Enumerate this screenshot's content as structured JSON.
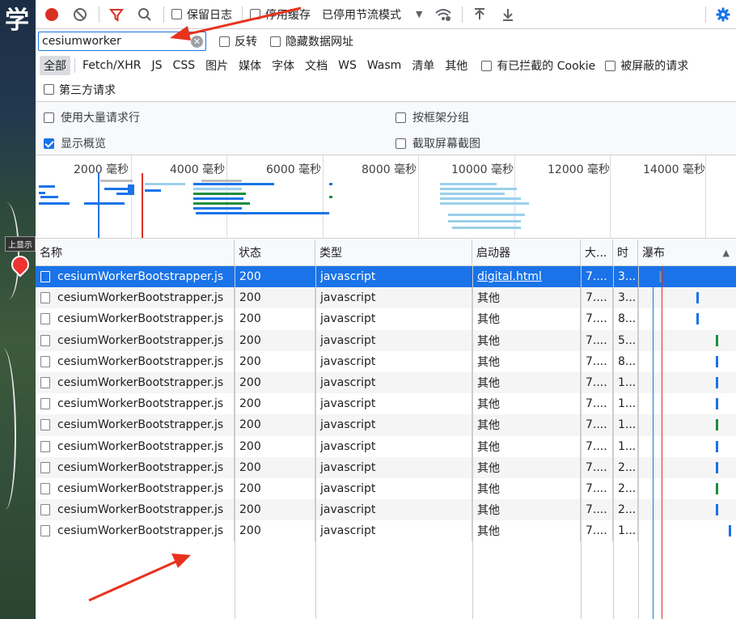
{
  "map": {
    "label": "上显示"
  },
  "toolbar": {
    "preserve_log": "保留日志",
    "disable_cache": "停用缓存",
    "throttle": "已停用节流模式"
  },
  "filter": {
    "value": "cesiumworker",
    "invert": "反转",
    "hide_data_urls": "隐藏数据网址"
  },
  "types": [
    "全部",
    "Fetch/XHR",
    "JS",
    "CSS",
    "图片",
    "媒体",
    "字体",
    "文档",
    "WS",
    "Wasm",
    "清单",
    "其他"
  ],
  "blocked_cookies": "有已拦截的 Cookie",
  "blocked_requests": "被屏蔽的请求",
  "third_party": "第三方请求",
  "settings": {
    "big_rows": "使用大量请求行",
    "group_by_frame": "按框架分组",
    "show_overview": "显示概览",
    "capture_screenshots": "截取屏幕截图"
  },
  "overview": {
    "ticks": [
      "2000 毫秒",
      "4000 毫秒",
      "6000 毫秒",
      "8000 毫秒",
      "10000 毫秒",
      "12000 毫秒",
      "14000 毫秒"
    ]
  },
  "columns": {
    "name": "名称",
    "status": "状态",
    "type": "类型",
    "initiator": "启动器",
    "size": "大...",
    "time": "时",
    "waterfall": "瀑布"
  },
  "rows": [
    {
      "name": "cesiumWorkerBootstrapper.js",
      "status": "200",
      "type": "javascript",
      "initiator": "digital.html",
      "size": "7....",
      "time": "3..."
    },
    {
      "name": "cesiumWorkerBootstrapper.js",
      "status": "200",
      "type": "javascript",
      "initiator": "其他",
      "size": "7....",
      "time": "3..."
    },
    {
      "name": "cesiumWorkerBootstrapper.js",
      "status": "200",
      "type": "javascript",
      "initiator": "其他",
      "size": "7....",
      "time": "8..."
    },
    {
      "name": "cesiumWorkerBootstrapper.js",
      "status": "200",
      "type": "javascript",
      "initiator": "其他",
      "size": "7....",
      "time": "5..."
    },
    {
      "name": "cesiumWorkerBootstrapper.js",
      "status": "200",
      "type": "javascript",
      "initiator": "其他",
      "size": "7....",
      "time": "8..."
    },
    {
      "name": "cesiumWorkerBootstrapper.js",
      "status": "200",
      "type": "javascript",
      "initiator": "其他",
      "size": "7....",
      "time": "1..."
    },
    {
      "name": "cesiumWorkerBootstrapper.js",
      "status": "200",
      "type": "javascript",
      "initiator": "其他",
      "size": "7....",
      "time": "1..."
    },
    {
      "name": "cesiumWorkerBootstrapper.js",
      "status": "200",
      "type": "javascript",
      "initiator": "其他",
      "size": "7....",
      "time": "1..."
    },
    {
      "name": "cesiumWorkerBootstrapper.js",
      "status": "200",
      "type": "javascript",
      "initiator": "其他",
      "size": "7....",
      "time": "1..."
    },
    {
      "name": "cesiumWorkerBootstrapper.js",
      "status": "200",
      "type": "javascript",
      "initiator": "其他",
      "size": "7....",
      "time": "2..."
    },
    {
      "name": "cesiumWorkerBootstrapper.js",
      "status": "200",
      "type": "javascript",
      "initiator": "其他",
      "size": "7....",
      "time": "2..."
    },
    {
      "name": "cesiumWorkerBootstrapper.js",
      "status": "200",
      "type": "javascript",
      "initiator": "其他",
      "size": "7....",
      "time": "2..."
    },
    {
      "name": "cesiumWorkerBootstrapper.js",
      "status": "200",
      "type": "javascript",
      "initiator": "其他",
      "size": "7....",
      "time": "1..."
    }
  ],
  "colors": {
    "accent": "#1a73e8",
    "record": "#d93025",
    "filter_active": "#d93025",
    "annotation_arrow": "#e8321e"
  }
}
